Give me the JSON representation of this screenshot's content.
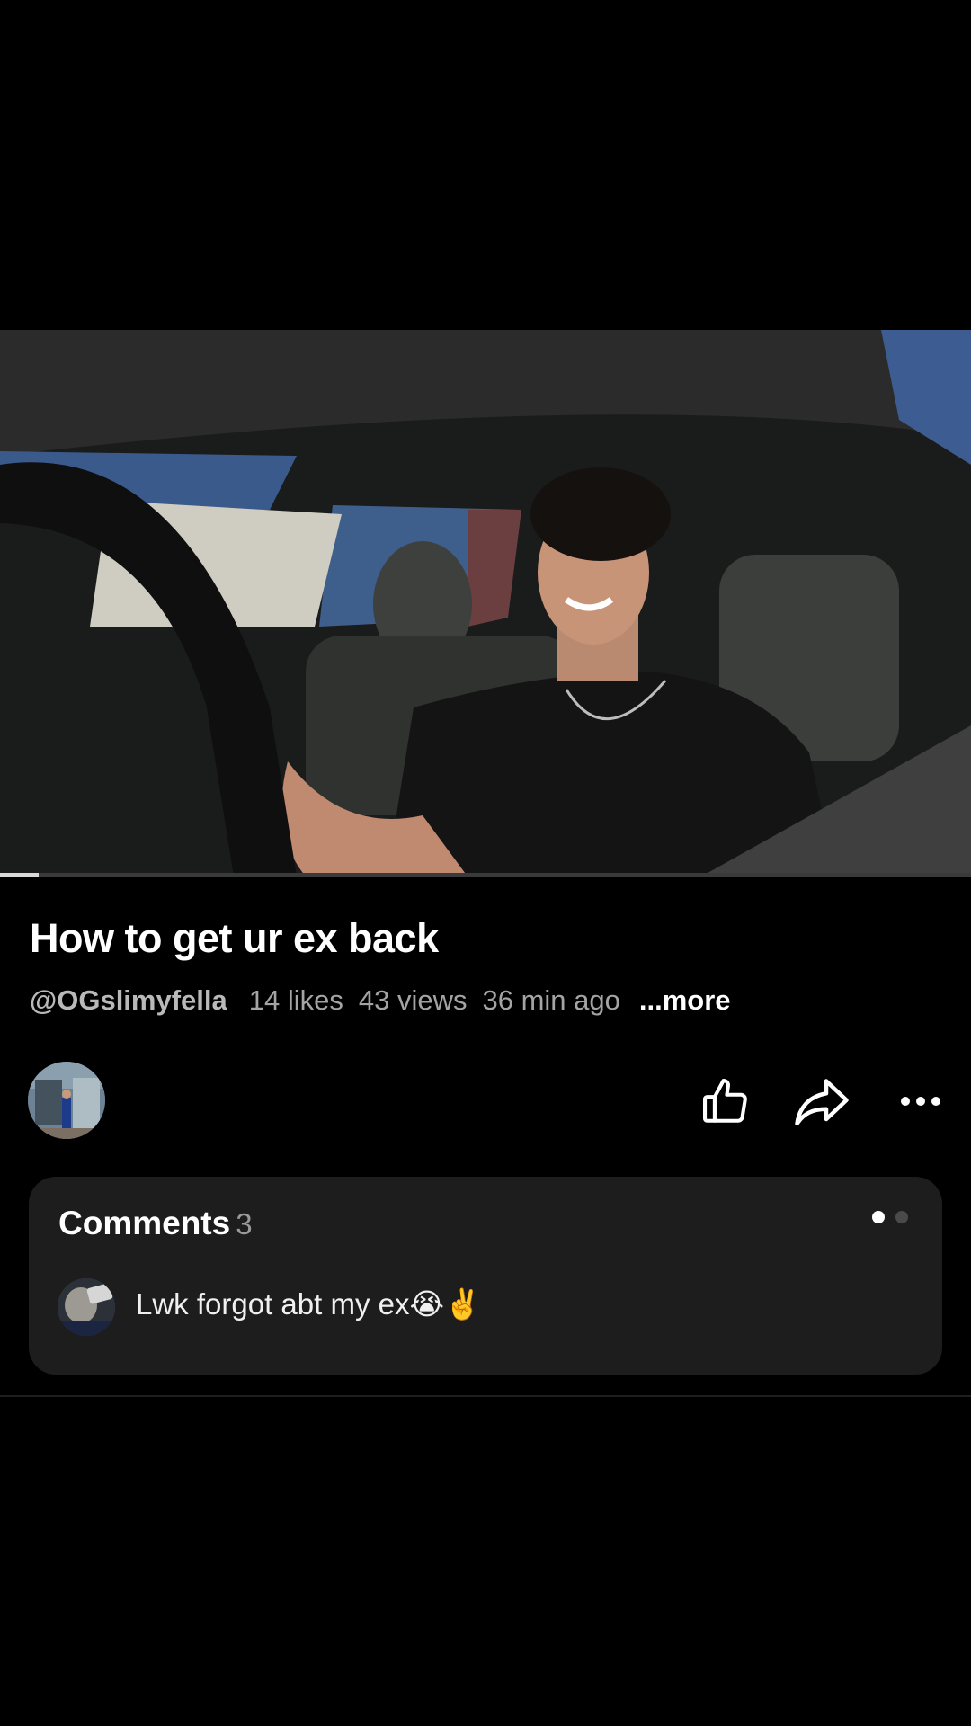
{
  "video": {
    "progress": 0.04,
    "thumbnail_description_icon": "video-frame"
  },
  "title": "How to get ur ex back",
  "meta": {
    "channel": "@OGslimyfella",
    "likes": "14 likes",
    "views": "43 views",
    "time": "36 min ago",
    "more": "...more"
  },
  "actions": {
    "avatar_icon": "channel-avatar",
    "like_icon": "thumbs-up-icon",
    "share_icon": "share-arrow-icon",
    "more_icon": "more-horizontal-icon"
  },
  "comments": {
    "label": "Comments",
    "count": "3",
    "pager_dots": 2,
    "active_dot": 0,
    "top_comment": {
      "text": "Lwk forgot abt my ex😭✌️"
    }
  },
  "colors": {
    "background": "#000000",
    "card": "#1d1d1d",
    "muted_text": "#a4a4a4"
  }
}
